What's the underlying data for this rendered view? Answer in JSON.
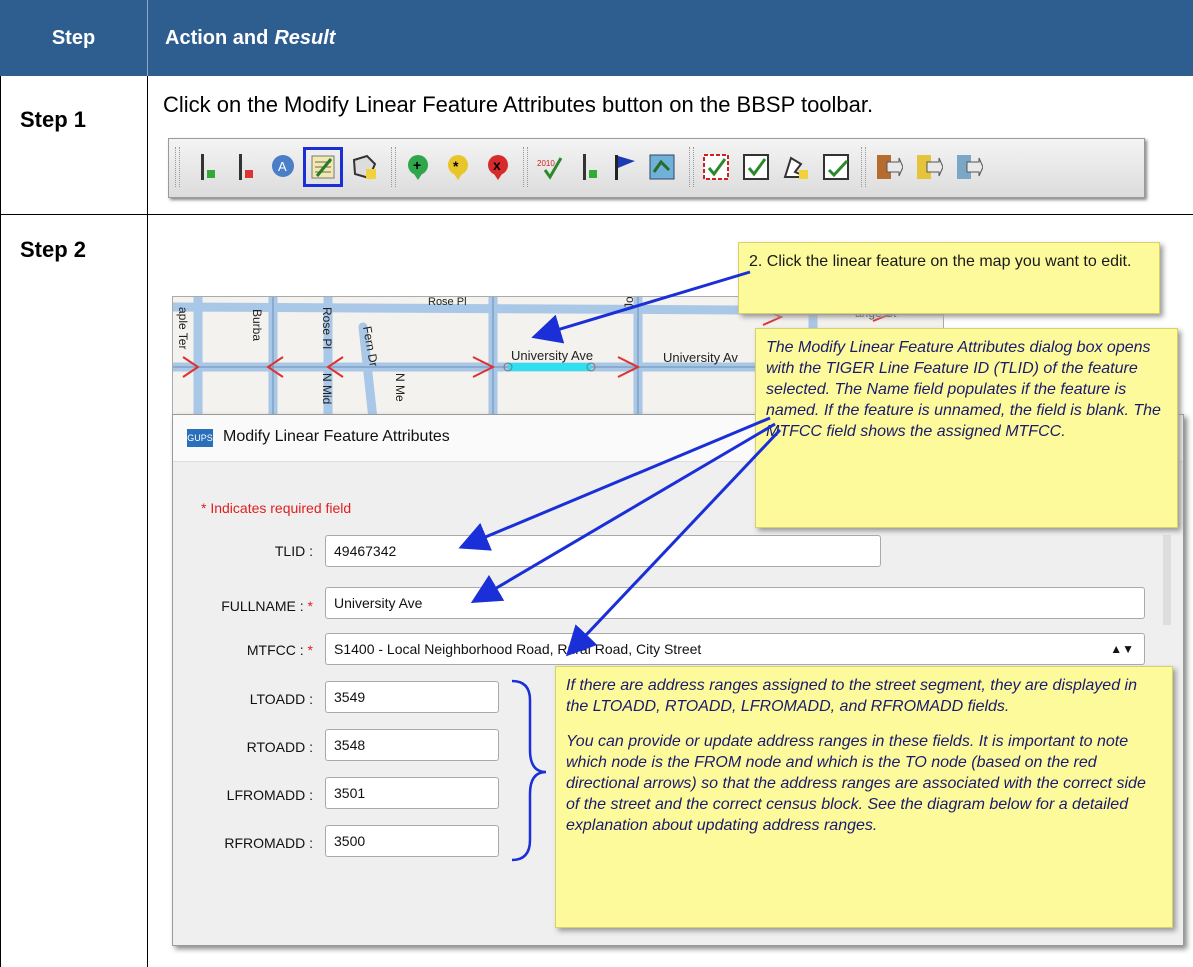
{
  "header": {
    "col1": "Step",
    "col2_plain": "Action and",
    "col2_italic": "Result"
  },
  "step1": {
    "label": "Step 1",
    "text": "Click on the Modify Linear Feature Attributes button on the BBSP toolbar.",
    "toolbar_icons": [
      "add-line-icon",
      "delete-line-icon",
      "address-icon",
      "modify-linear-feature-icon",
      "boundary-icon",
      "add-point-icon",
      "modify-point-icon",
      "delete-point-icon",
      "2010-check-icon",
      "line-flag-icon",
      "flag-icon",
      "map-icon",
      "review-icon",
      "check-icon",
      "polygon-icon",
      "check-box-icon",
      "export-icon",
      "export-yellow-icon",
      "export-blue-icon"
    ]
  },
  "step2": {
    "label": "Step 2",
    "map_labels": [
      "University Ave",
      "University Av",
      "Rose Pl",
      "N Mid",
      "Fern Dr",
      "N Me",
      "Joyce Erd",
      "Burba",
      "aple Ter",
      "Rose Pl",
      "ange St"
    ],
    "dialog": {
      "title": "Modify Linear Feature Attributes",
      "icon_text": "GUPS",
      "required_note": "* Indicates required field",
      "fields": {
        "tlid": {
          "label": "TLID :",
          "value": "49467342"
        },
        "fullname": {
          "label": "FULLNAME :",
          "value": "University Ave"
        },
        "mtfcc": {
          "label": "MTFCC :",
          "value": "S1400 - Local Neighborhood Road, Rural Road, City Street"
        },
        "ltoadd": {
          "label": "LTOADD :",
          "value": "3549"
        },
        "rtoadd": {
          "label": "RTOADD :",
          "value": "3548"
        },
        "lfromadd": {
          "label": "LFROMADD :",
          "value": "3501"
        },
        "rfromadd": {
          "label": "RFROMADD :",
          "value": "3500"
        }
      },
      "required_star": "*"
    },
    "callouts": {
      "click_feature": "2. Click the linear feature on the map you want to edit.",
      "dialog_opens": "The Modify Linear Feature Attributes dialog box opens with the TIGER Line Feature ID (TLID) of the feature selected. The Name field populates if the feature is named. If the feature is unnamed, the field is blank. The MTFCC field shows the assigned MTFCC.",
      "address_ranges_1": "If there are address ranges assigned to the street segment, they are displayed in the LTOADD, RTOADD, LFROMADD, and RFROMADD fields.",
      "address_ranges_2": "You can provide or update address ranges in these fields. It is important to note which node is the FROM node and which is the TO node (based on the red directional arrows) so that the address ranges are associated with the correct side of the street and the correct census block.  See the diagram below for a detailed explanation about updating address ranges."
    }
  },
  "colors": {
    "header_bg": "#2e5d90",
    "note_bg": "#fdfa9b",
    "arrow": "#1a2fd8",
    "required": "#e02020"
  }
}
